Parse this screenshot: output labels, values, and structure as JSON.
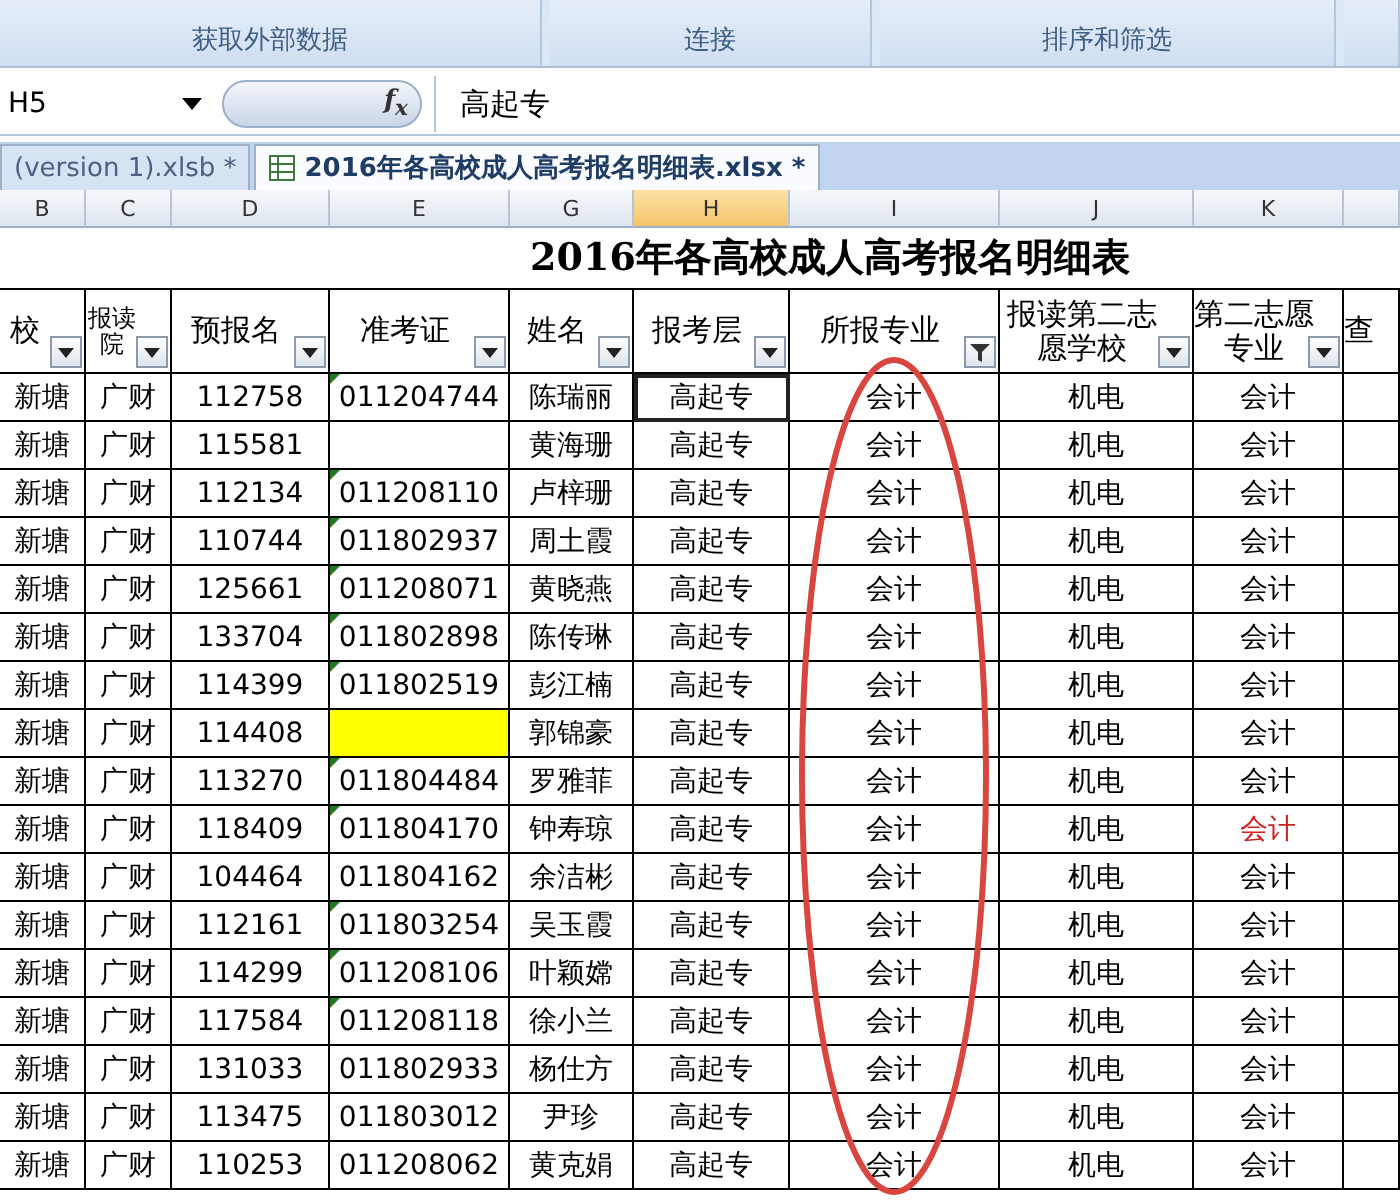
{
  "ribbon": {
    "groups": [
      "获取外部数据",
      "连接",
      "排序和筛选"
    ]
  },
  "formula_bar": {
    "name_box": "H5",
    "fx_label": "f$_{x}$",
    "formula": "高起专"
  },
  "workbook_tabs": [
    {
      "label": "(version 1).xlsb *",
      "selected": false
    },
    {
      "label": "2016年各高校成人高考报名明细表.xlsx *",
      "selected": true
    }
  ],
  "column_letters": [
    {
      "label": "B",
      "selected": false
    },
    {
      "label": "C",
      "selected": false
    },
    {
      "label": "D",
      "selected": false
    },
    {
      "label": "E",
      "selected": false
    },
    {
      "label": "G",
      "selected": false
    },
    {
      "label": "H",
      "selected": true
    },
    {
      "label": "I",
      "selected": false
    },
    {
      "label": "J",
      "selected": false
    },
    {
      "label": "K",
      "selected": false
    }
  ],
  "sheet": {
    "title": "2016年各高校成人高考报名明细表",
    "headers": [
      {
        "label": "校",
        "filtered": false
      },
      {
        "label": "报读院",
        "filtered": false
      },
      {
        "label": "预报名",
        "filtered": false
      },
      {
        "label": "准考证",
        "filtered": false
      },
      {
        "label": "姓名",
        "filtered": false
      },
      {
        "label": "报考层",
        "filtered": false
      },
      {
        "label": "所报专业",
        "filtered": true
      },
      {
        "label": "报读第二志愿学校",
        "filtered": false
      },
      {
        "label": "第二志愿专业",
        "filtered": false
      },
      {
        "label": "查"
      }
    ],
    "rows": [
      {
        "cells": [
          "新塘",
          "广财",
          "112758",
          "011204744",
          "陈瑞丽",
          "高起专",
          "会计",
          "机电",
          "会计"
        ],
        "marker": true,
        "highlighted": false,
        "alert": false,
        "active": true
      },
      {
        "cells": [
          "新塘",
          "广财",
          "115581",
          null,
          "黄海珊",
          "高起专",
          "会计",
          "机电",
          "会计"
        ],
        "marker": false,
        "highlighted": false,
        "alert": false,
        "active": false
      },
      {
        "cells": [
          "新塘",
          "广财",
          "112134",
          "011208110",
          "卢梓珊",
          "高起专",
          "会计",
          "机电",
          "会计"
        ],
        "marker": true,
        "highlighted": false,
        "alert": false,
        "active": false
      },
      {
        "cells": [
          "新塘",
          "广财",
          "110744",
          "011802937",
          "周土霞",
          "高起专",
          "会计",
          "机电",
          "会计"
        ],
        "marker": true,
        "highlighted": false,
        "alert": false,
        "active": false
      },
      {
        "cells": [
          "新塘",
          "广财",
          "125661",
          "011208071",
          "黄晓燕",
          "高起专",
          "会计",
          "机电",
          "会计"
        ],
        "marker": true,
        "highlighted": false,
        "alert": false,
        "active": false
      },
      {
        "cells": [
          "新塘",
          "广财",
          "133704",
          "011802898",
          "陈传琳",
          "高起专",
          "会计",
          "机电",
          "会计"
        ],
        "marker": true,
        "highlighted": false,
        "alert": false,
        "active": false
      },
      {
        "cells": [
          "新塘",
          "广财",
          "114399",
          "011802519",
          "彭江楠",
          "高起专",
          "会计",
          "机电",
          "会计"
        ],
        "marker": true,
        "highlighted": false,
        "alert": false,
        "active": false
      },
      {
        "cells": [
          "新塘",
          "广财",
          "114408",
          null,
          "郭锦豪",
          "高起专",
          "会计",
          "机电",
          "会计"
        ],
        "marker": false,
        "highlighted": true,
        "alert": false,
        "active": false
      },
      {
        "cells": [
          "新塘",
          "广财",
          "113270",
          "011804484",
          "罗雅菲",
          "高起专",
          "会计",
          "机电",
          "会计"
        ],
        "marker": true,
        "highlighted": false,
        "alert": false,
        "active": false
      },
      {
        "cells": [
          "新塘",
          "广财",
          "118409",
          "011804170",
          "钟寿琼",
          "高起专",
          "会计",
          "机电",
          "会计"
        ],
        "marker": true,
        "highlighted": false,
        "alert": true,
        "active": false
      },
      {
        "cells": [
          "新塘",
          "广财",
          "104464",
          "011804162",
          "余洁彬",
          "高起专",
          "会计",
          "机电",
          "会计"
        ],
        "marker": false,
        "highlighted": false,
        "alert": false,
        "active": false
      },
      {
        "cells": [
          "新塘",
          "广财",
          "112161",
          "011803254",
          "吴玉霞",
          "高起专",
          "会计",
          "机电",
          "会计"
        ],
        "marker": true,
        "highlighted": false,
        "alert": false,
        "active": false
      },
      {
        "cells": [
          "新塘",
          "广财",
          "114299",
          "011208106",
          "叶颖嫦",
          "高起专",
          "会计",
          "机电",
          "会计"
        ],
        "marker": true,
        "highlighted": false,
        "alert": false,
        "active": false
      },
      {
        "cells": [
          "新塘",
          "广财",
          "117584",
          "011208118",
          "徐小兰",
          "高起专",
          "会计",
          "机电",
          "会计"
        ],
        "marker": true,
        "highlighted": false,
        "alert": false,
        "active": false
      },
      {
        "cells": [
          "新塘",
          "广财",
          "131033",
          "011802933",
          "杨仕方",
          "高起专",
          "会计",
          "机电",
          "会计"
        ],
        "marker": false,
        "highlighted": false,
        "alert": false,
        "active": false
      },
      {
        "cells": [
          "新塘",
          "广财",
          "113475",
          "011803012",
          "尹珍",
          "高起专",
          "会计",
          "机电",
          "会计"
        ],
        "marker": false,
        "highlighted": false,
        "alert": false,
        "active": false
      },
      {
        "cells": [
          "新塘",
          "广财",
          "110253",
          "011208062",
          "黄克娟",
          "高起专",
          "会计",
          "机电",
          "会计"
        ],
        "marker": false,
        "highlighted": false,
        "alert": false,
        "active": false
      }
    ]
  }
}
